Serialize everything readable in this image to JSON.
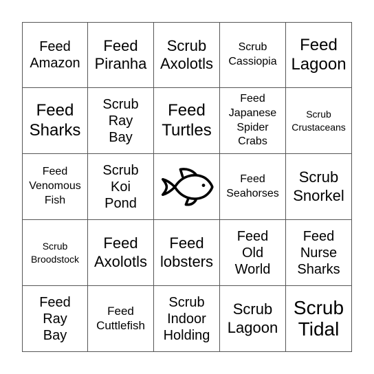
{
  "board": {
    "free_space_icon": "fish-icon",
    "grid_color": "#555555",
    "cells": [
      {
        "text": "Feed\nAmazon",
        "size": "fs-m"
      },
      {
        "text": "Feed\nPiranha",
        "size": "fs-ml"
      },
      {
        "text": "Scrub\nAxolotls",
        "size": "fs-ml"
      },
      {
        "text": "Scrub\nCassiopia",
        "size": "fs-xs"
      },
      {
        "text": "Feed\nLagoon",
        "size": "fs-l"
      },
      {
        "text": "Feed\nSharks",
        "size": "fs-l"
      },
      {
        "text": "Scrub\nRay\nBay",
        "size": "fs-m"
      },
      {
        "text": "Feed\nTurtles",
        "size": "fs-l"
      },
      {
        "text": "Feed\nJapanese\nSpider\nCrabs",
        "size": "fs-xs"
      },
      {
        "text": "Scrub\nCrustaceans",
        "size": "fs-xxs"
      },
      {
        "text": "Feed\nVenomous\nFish",
        "size": "fs-xs"
      },
      {
        "text": "Scrub\nKoi\nPond",
        "size": "fs-m"
      },
      {
        "text": "",
        "size": "",
        "free": true
      },
      {
        "text": "Feed\nSeahorses",
        "size": "fs-xs"
      },
      {
        "text": "Scrub\nSnorkel",
        "size": "fs-ml"
      },
      {
        "text": "Scrub\nBroodstock",
        "size": "fs-xxs"
      },
      {
        "text": "Feed\nAxolotls",
        "size": "fs-ml"
      },
      {
        "text": "Feed\nlobsters",
        "size": "fs-ml"
      },
      {
        "text": "Feed\nOld\nWorld",
        "size": "fs-m"
      },
      {
        "text": "Feed\nNurse\nSharks",
        "size": "fs-m"
      },
      {
        "text": "Feed\nRay\nBay",
        "size": "fs-m"
      },
      {
        "text": "Feed\nCuttlefish",
        "size": "fs-s"
      },
      {
        "text": "Scrub\nIndoor\nHolding",
        "size": "fs-m"
      },
      {
        "text": "Scrub\nLagoon",
        "size": "fs-ml"
      },
      {
        "text": "Scrub\nTidal",
        "size": "fs-xl"
      }
    ]
  }
}
